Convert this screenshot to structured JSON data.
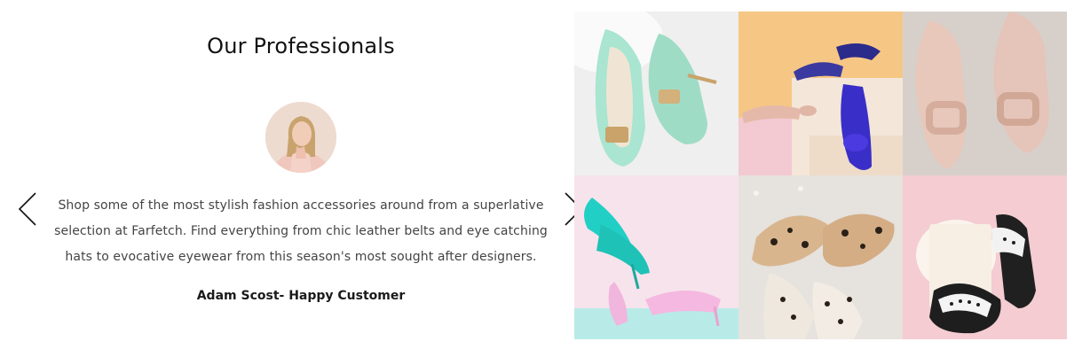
{
  "testimonial": {
    "title": "Our Professionals",
    "quote": "Shop some of the most stylish fashion accessories around from a superlative selection at Farfetch. Find everything from chic leather belts and eye catching hats to evocative eyewear from this season's most sought after designers.",
    "author": "Adam Scost- Happy Customer",
    "prev_icon": "chevron-left-icon",
    "next_icon": "chevron-right-icon"
  },
  "gallery": {
    "tiles": [
      {
        "subject": "mint-green-heels",
        "bg": "#eeeeee"
      },
      {
        "subject": "blue-flats-on-pastel-blocks",
        "bg": "#f6c784"
      },
      {
        "subject": "nude-buckle-flats",
        "bg": "#d9d2cb"
      },
      {
        "subject": "teal-and-pink-pumps",
        "bg": "#f4dbe6"
      },
      {
        "subject": "leopard-print-loafers",
        "bg": "#e5e0da"
      },
      {
        "subject": "black-white-slide-sandals",
        "bg": "#f2c9cf"
      }
    ]
  },
  "colors": {
    "text": "#444444",
    "heading": "#111111",
    "background": "#ffffff"
  }
}
